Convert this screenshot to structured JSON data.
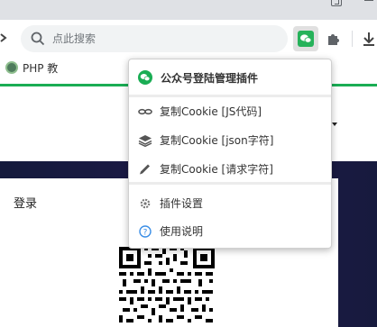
{
  "browser": {
    "omnibox": {
      "placeholder": "点此搜索"
    },
    "bookmarks": [
      {
        "label": "PHP 教"
      }
    ]
  },
  "popup": {
    "title": "公众号登陆管理插件",
    "items": [
      {
        "label": "复制Cookie [JS代码]",
        "icon": "link-icon"
      },
      {
        "label": "复制Cookie [json字符]",
        "icon": "layers-icon"
      },
      {
        "label": "复制Cookie [请求字符]",
        "icon": "pencil-icon"
      },
      {
        "label": "插件设置",
        "icon": "gear-icon"
      },
      {
        "label": "使用说明",
        "icon": "help-icon"
      }
    ]
  },
  "page": {
    "login_title": "登录"
  },
  "colors": {
    "accent_green": "#1aad54",
    "page_dark_band": "#1b1b46"
  }
}
